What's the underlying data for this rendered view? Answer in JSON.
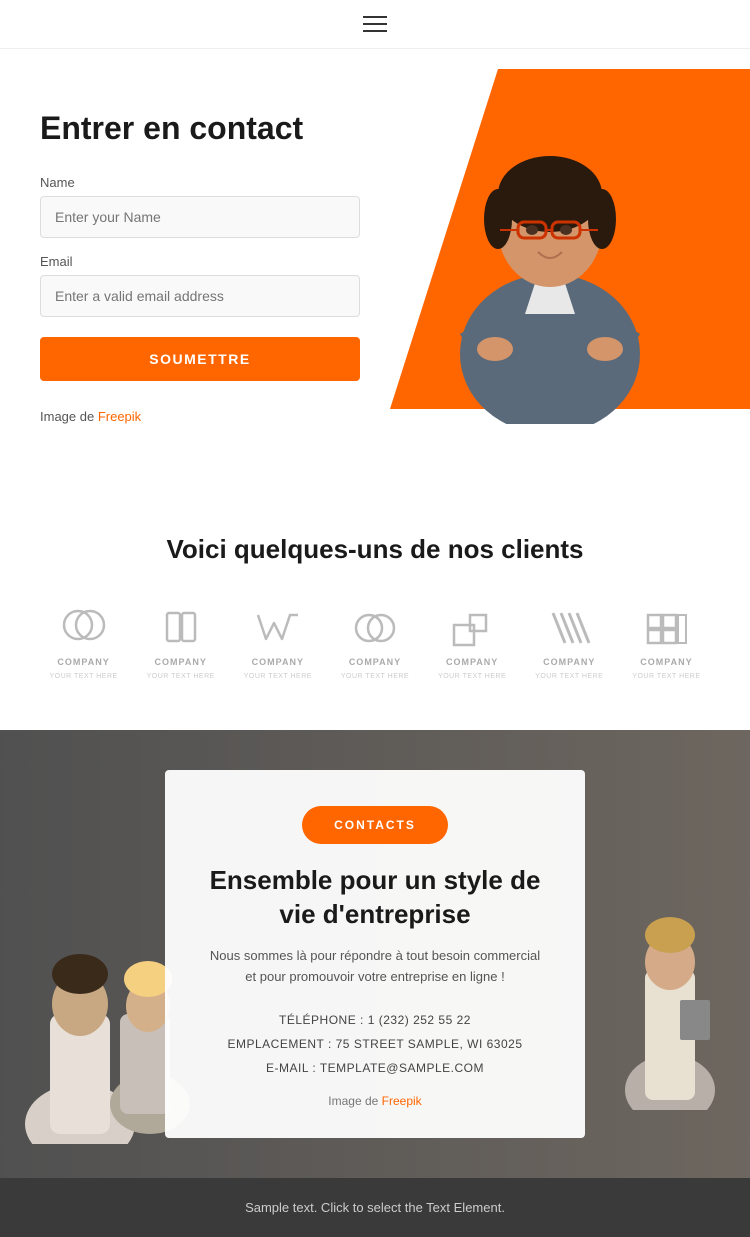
{
  "header": {
    "menu_icon_label": "Menu"
  },
  "hero": {
    "title": "Entrer en contact",
    "name_label": "Name",
    "name_placeholder": "Enter your Name",
    "email_label": "Email",
    "email_placeholder": "Enter a valid email address",
    "submit_label": "SOUMETTRE",
    "image_credit_text": "Image de ",
    "image_credit_link": "Freepik"
  },
  "clients": {
    "title": "Voici quelques-uns de nos clients",
    "logos": [
      {
        "id": 1,
        "label": "COMPANY"
      },
      {
        "id": 2,
        "label": "COMPANY"
      },
      {
        "id": 3,
        "label": "COMPANY"
      },
      {
        "id": 4,
        "label": "COMPANY"
      },
      {
        "id": 5,
        "label": "COMPANY"
      },
      {
        "id": 6,
        "label": "COMPANY"
      },
      {
        "id": 7,
        "label": "COMPANY"
      }
    ]
  },
  "cta": {
    "button_label": "CONTACTS",
    "title": "Ensemble pour un style de vie d'entreprise",
    "description": "Nous sommes là pour répondre à tout besoin commercial et pour promouvoir votre entreprise en ligne !",
    "phone": "TÉLÉPHONE : 1 (232) 252 55 22",
    "location": "EMPLACEMENT : 75 STREET SAMPLE, WI 63025",
    "email": "E-MAIL : TEMPLATE@SAMPLE.COM",
    "image_credit_text": "Image de ",
    "image_credit_link": "Freepik"
  },
  "footer": {
    "text": "Sample text. Click to select the Text Element."
  },
  "colors": {
    "accent": "#ff6600",
    "dark": "#1a1a1a",
    "light_gray": "#f9f9f9"
  }
}
